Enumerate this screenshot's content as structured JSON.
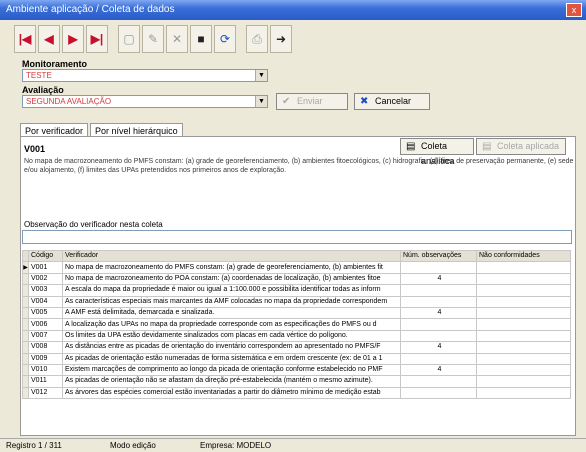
{
  "window": {
    "title": "Ambiente aplicação / Coleta de dados",
    "close": "x"
  },
  "toolbar": {
    "first": "|◀",
    "prev": "◀",
    "next": "▶",
    "last": "▶|",
    "new": "▢",
    "edit": "✎",
    "delete": "✕",
    "save": "■",
    "refresh": "⟳",
    "print": "⎙",
    "exit": "➜"
  },
  "monitoramento": {
    "label": "Monitoramento",
    "value": "TESTE"
  },
  "avaliacao": {
    "label": "Avaliação",
    "value": "SEGUNDA AVALIAÇÃO"
  },
  "actions": {
    "enviar": "Enviar",
    "cancelar": "Cancelar"
  },
  "tabs": [
    "Por verificador",
    "Por nível hierárquico"
  ],
  "verificador": {
    "code": "V001",
    "coleta_analitica": "Coleta analítica",
    "coleta_aplicada": "Coleta aplicada",
    "description": "No mapa de macrozoneamento do PMFS constam: (a) grade de georeferenciamento, (b) ambientes fitoecológicos, (c) hidrografia, (d) área de preservação permanente, (e) sede e/ou alojamento, (f) limites das UPAs pretendidos nos primeiros anos de exploração.",
    "obs_label": "Observação do verificador nesta coleta",
    "obs_value": ""
  },
  "grid": {
    "headers": [
      "Código",
      "Verificador",
      "Núm. observações",
      "Não conformidades"
    ],
    "rows": [
      {
        "code": "V001",
        "text": "No mapa de macrozoneamento do PMFS constam: (a) grade de georeferenciamento, (b) ambientes fit",
        "obs": "",
        "nc": ""
      },
      {
        "code": "V002",
        "text": "No mapa de macrozoneamento do POA constam: (a) coordenadas de localização, (b) ambientes fitoe",
        "obs": "4",
        "nc": ""
      },
      {
        "code": "V003",
        "text": "A escala do mapa da propriedade é maior ou igual a 1:100.000 e possibilita identificar todas as inform",
        "obs": "",
        "nc": ""
      },
      {
        "code": "V004",
        "text": "As características especiais mais marcantes da AMF colocadas no mapa da propriedade correspondem",
        "obs": "",
        "nc": ""
      },
      {
        "code": "V005",
        "text": "A AMF está delimitada, demarcada e sinalizada.",
        "obs": "4",
        "nc": ""
      },
      {
        "code": "V006",
        "text": "A localização das UPAs no mapa da propriedade corresponde com as especificações do PMFS ou d",
        "obs": "",
        "nc": ""
      },
      {
        "code": "V007",
        "text": "Os limites da UPA estão devidamente sinalizados com placas em cada vértice do polígono.",
        "obs": "",
        "nc": ""
      },
      {
        "code": "V008",
        "text": "As distâncias entre as picadas de orientação do inventário correspondem ao apresentado no PMFS/F",
        "obs": "4",
        "nc": ""
      },
      {
        "code": "V009",
        "text": "As picadas de orientação estão numeradas de forma sistemática e em ordem crescente (ex: de 01 a 1",
        "obs": "",
        "nc": ""
      },
      {
        "code": "V010",
        "text": "Existem marcações de comprimento ao longo da picada de orientação conforme estabelecido no PMF",
        "obs": "4",
        "nc": ""
      },
      {
        "code": "V011",
        "text": "As picadas de orientação não se afastam da direção pré-estabelecida (mantém o mesmo azimute).",
        "obs": "",
        "nc": ""
      },
      {
        "code": "V012",
        "text": "As árvores das espécies comercial estão inventariadas a partir do diâmetro mínimo de medição estab",
        "obs": "",
        "nc": ""
      }
    ]
  },
  "status": {
    "registro": "Registro 1 / 311",
    "modo": "Modo edição",
    "empresa": "Empresa: MODELO"
  }
}
